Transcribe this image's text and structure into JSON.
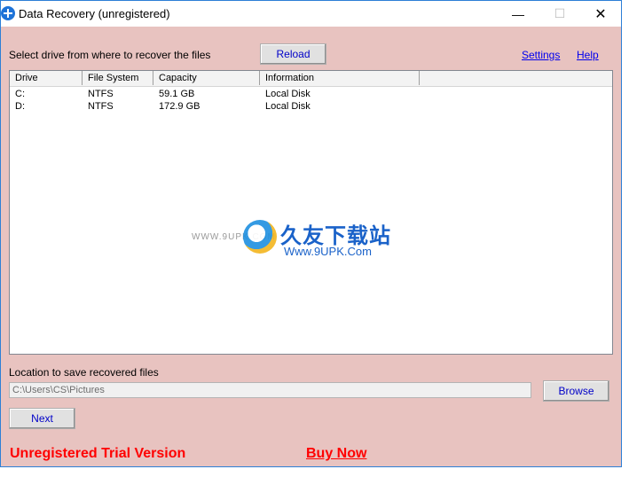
{
  "window": {
    "title": "Data Recovery (unregistered)"
  },
  "controls": {
    "minimize": "—",
    "maximize": "☐",
    "close": "✕"
  },
  "main": {
    "select_label": "Select drive from where to recover the files",
    "reload": "Reload",
    "settings": "Settings",
    "help": "Help"
  },
  "drives": {
    "columns": [
      "Drive",
      "File System",
      "Capacity",
      "Information",
      ""
    ],
    "rows": [
      {
        "drive": "C:",
        "fs": "NTFS",
        "capacity": "59.1 GB",
        "info": "Local Disk"
      },
      {
        "drive": "D:",
        "fs": "NTFS",
        "capacity": "172.9 GB",
        "info": "Local Disk"
      }
    ]
  },
  "watermark": {
    "small_url": "WWW.9UPK.COM",
    "cn": "久友下载站",
    "url": "Www.9UPK.Com"
  },
  "save": {
    "label": "Location to save recovered files",
    "path": "C:\\Users\\CS\\Pictures",
    "browse": "Browse"
  },
  "footer": {
    "next": "Next",
    "trial": "Unregistered Trial Version",
    "buy": "Buy Now"
  },
  "colors": {
    "background": "#e8c3c0",
    "trial_red": "#ff0000",
    "link_blue": "#0000ee"
  }
}
